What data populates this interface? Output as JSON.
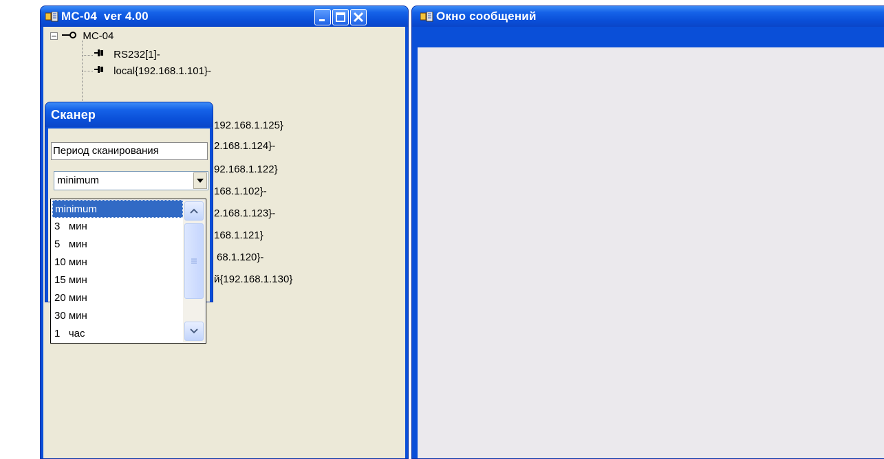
{
  "left_window": {
    "title": "МС-04  ver 4.00",
    "tree": [
      {
        "label": "МС-04"
      },
      {
        "label": "RS232[1]-"
      },
      {
        "label": "local{192.168.1.101}-"
      },
      {
        "label": "192.168.1.125}"
      },
      {
        "label": "2.168.1.124}-"
      },
      {
        "label": "92.168.1.122}"
      },
      {
        "label": "168.1.102}-"
      },
      {
        "label": "2.168.1.123}-"
      },
      {
        "label": "168.1.121}"
      },
      {
        "label": "68.1.120}-"
      },
      {
        "label": "й{192.168.1.130}"
      }
    ]
  },
  "right_window": {
    "title": "Окно сообщений"
  },
  "scanner": {
    "title": "Сканер",
    "period_label": "Период сканирования",
    "selected_value": "minimum",
    "options": [
      "minimum",
      "3   мин",
      "5   мин",
      "10 мин",
      "15 мин",
      "20 мин",
      "30 мин",
      "1   час"
    ]
  }
}
